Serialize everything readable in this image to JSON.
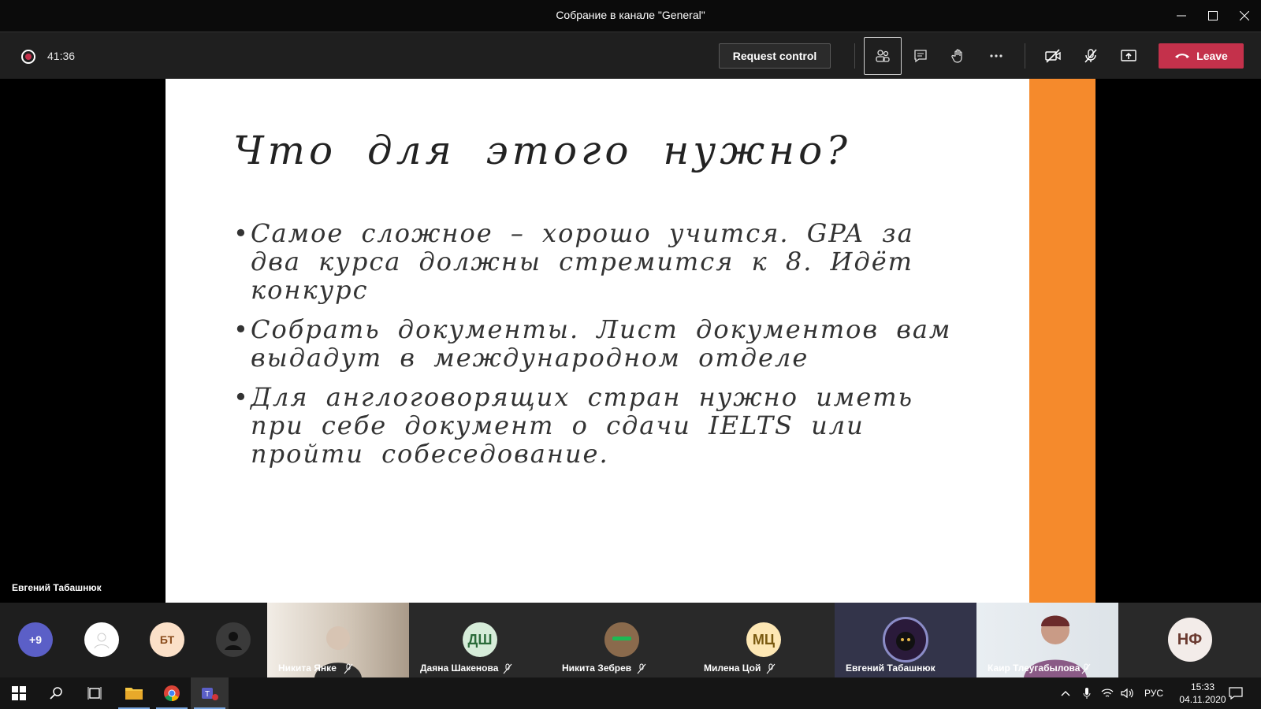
{
  "window": {
    "title": "Собрание в канале \"General\""
  },
  "toolbar": {
    "timer": "41:36",
    "request_control": "Request control",
    "leave": "Leave"
  },
  "slide": {
    "title": "Что для этого нужно?",
    "bullets": [
      "Самое сложное – хорошо учится. GPA за два курса должны стремится к 8. Идёт конкурс",
      "Собрать документы. Лист документов вам выдадут в международном отделе",
      "Для англоговорящих стран нужно иметь при себе документ о сдачи IELTS или пройти собеседование."
    ],
    "accent_color": "#f58a2c"
  },
  "presenter": "Евгений Табашнюк",
  "participants": {
    "overflow": "+9",
    "initials_bt": "БТ",
    "tiles": [
      {
        "name": "Никита Янке"
      },
      {
        "name": "Даяна Шакенова",
        "initials": "ДШ"
      },
      {
        "name": "Никита Зебрев"
      },
      {
        "name": "Милена Цой",
        "initials": "МЦ"
      },
      {
        "name": "Евгений Табашнюк"
      },
      {
        "name": "Каир Тлеугабылова"
      },
      {
        "initials": "НФ"
      }
    ]
  },
  "taskbar": {
    "language": "РУС",
    "time": "15:33",
    "date": "04.11.2020"
  },
  "colors": {
    "leave": "#c4314b",
    "toolbar": "#1f1f1f",
    "strip": "#1e1e1e"
  }
}
